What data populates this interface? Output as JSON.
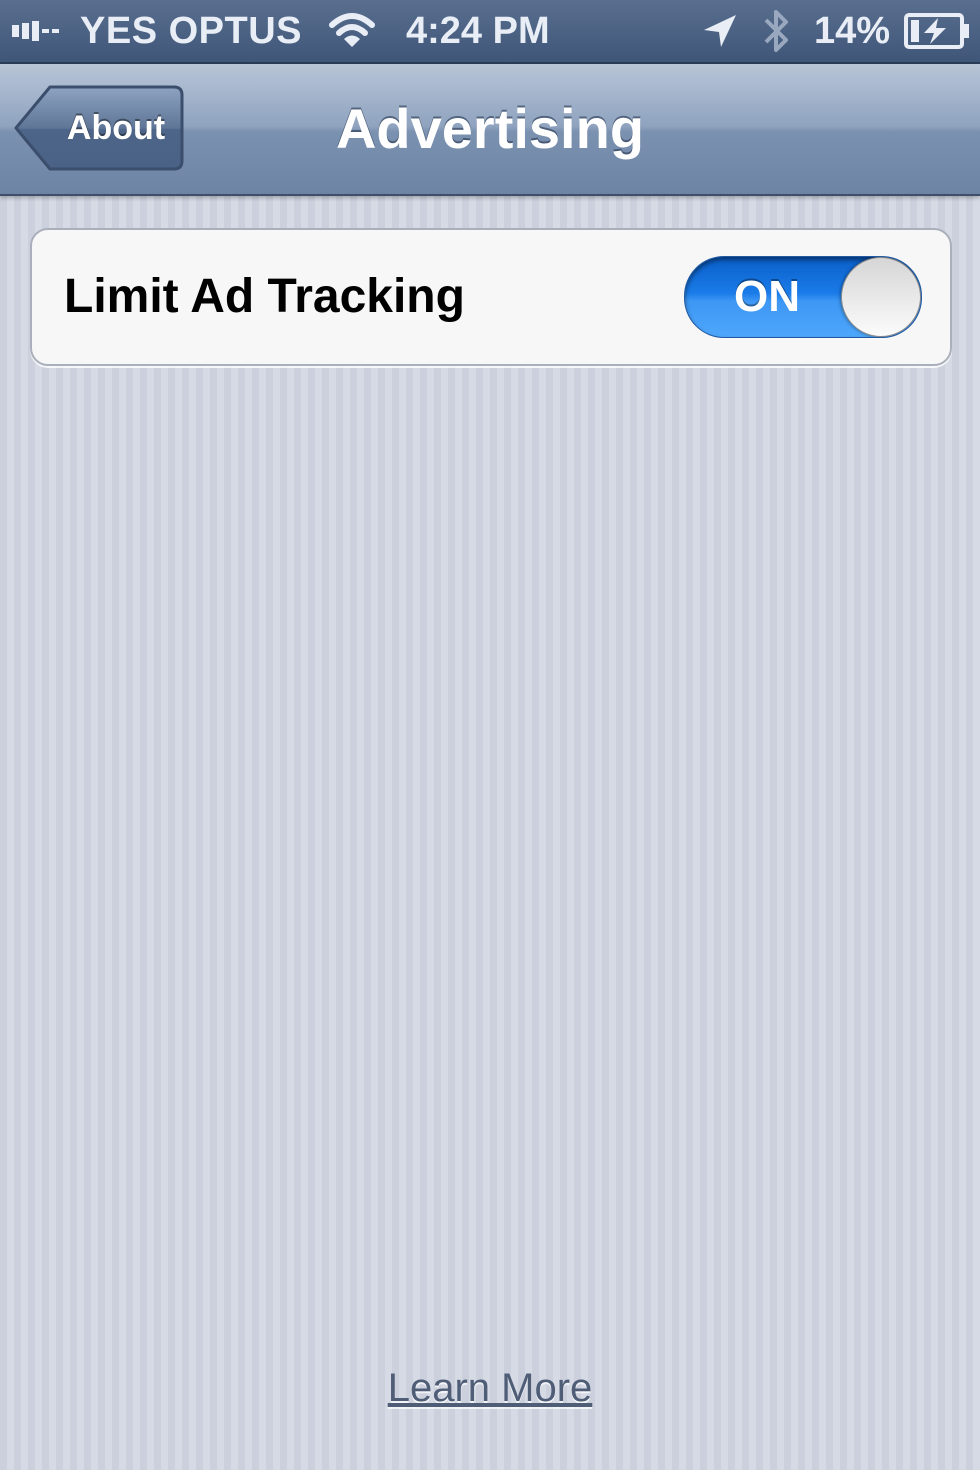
{
  "status_bar": {
    "carrier": "YES OPTUS",
    "time": "4:24 PM",
    "battery_percent": "14%",
    "icons": [
      "signal-icon",
      "wifi-icon",
      "location-icon",
      "bluetooth-icon",
      "battery-charging-icon"
    ]
  },
  "nav": {
    "back_label": "About",
    "title": "Advertising"
  },
  "settings": {
    "rows": [
      {
        "label": "Limit Ad Tracking",
        "toggle_label": "ON",
        "toggle_on": true
      }
    ]
  },
  "footer": {
    "link": "Learn More"
  },
  "colors": {
    "nav_bar": "#8fa3bf",
    "status_bar": "#3f5679",
    "toggle_on": "#1a7be8",
    "background": "#cfd3de"
  }
}
